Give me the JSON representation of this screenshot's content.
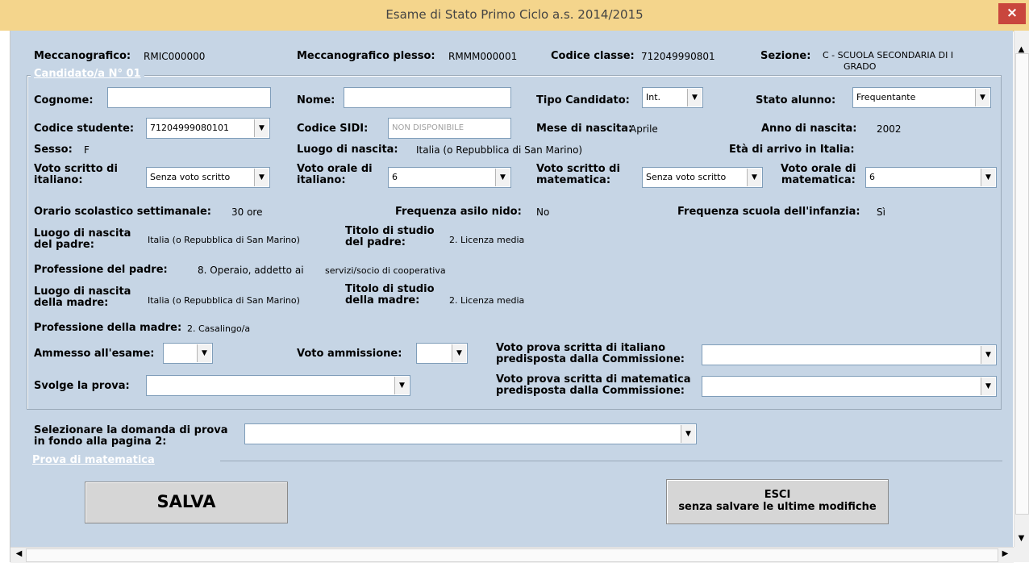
{
  "window": {
    "title": "Esame di Stato Primo Ciclo a.s. 2014/2015",
    "close_glyph": "×"
  },
  "header": {
    "meccanografico_label": "Meccanografico:",
    "meccanografico_value": "RMIC000000",
    "plesso_label": "Meccanografico plesso:",
    "plesso_value": "RMMM000001",
    "classe_label": "Codice classe:",
    "classe_value": "712049990801",
    "sezione_label": "Sezione:",
    "sezione_value_1": "C - SCUOLA SECONDARIA DI I",
    "sezione_value_2": "GRADO"
  },
  "candidate_frame": {
    "title": "Candidato/a N° 01",
    "cognome_label": "Cognome:",
    "cognome_value": "",
    "nome_label": "Nome:",
    "nome_value": "",
    "tipo_label": "Tipo Candidato:",
    "tipo_value": "Int.",
    "stato_label": "Stato alunno:",
    "stato_value": "Frequentante",
    "codice_studente_label": "Codice studente:",
    "codice_studente_value": "71204999080101",
    "codice_sidi_label": "Codice SIDI:",
    "codice_sidi_value": "NON DISPONIBILE",
    "mese_label": "Mese di nascita:",
    "mese_value": "Aprile",
    "anno_label": "Anno di nascita:",
    "anno_value": "2002",
    "sesso_label": "Sesso:",
    "sesso_value": "F",
    "luogo_label": "Luogo di nascita:",
    "luogo_value": "Italia (o Repubblica di San Marino)",
    "eta_label": "Età di arrivo in Italia:",
    "vsi_label_1": "Voto scritto di",
    "vsi_label_2": "italiano:",
    "vsi_value": "Senza voto scritto",
    "voi_label_1": "Voto orale di",
    "voi_label_2": "italiano:",
    "voi_value": "6",
    "vsm_label_1": "Voto scritto di",
    "vsm_label_2": "matematica:",
    "vsm_value": "Senza voto scritto",
    "vom_label_1": "Voto orale di",
    "vom_label_2": "matematica:",
    "vom_value": "6",
    "orario_label": "Orario scolastico settimanale:",
    "orario_value": "30 ore",
    "asilo_label": "Frequenza asilo nido:",
    "asilo_value": "No",
    "infanzia_label": "Frequenza scuola dell'infanzia:",
    "infanzia_value": "Sì",
    "lnp_label_1": "Luogo di nascita",
    "lnp_label_2": "del padre:",
    "lnp_value": "Italia (o Repubblica di San Marino)",
    "tsp_label_1": "Titolo di studio",
    "tsp_label_2": "del padre:",
    "tsp_value": "2. Licenza media",
    "prof_padre_label": "Professione del padre:",
    "prof_padre_value_a": "8. Operaio, addetto ai",
    "prof_padre_value_b": "servizi/socio di cooperativa",
    "lnm_label_1": "Luogo di nascita",
    "lnm_label_2": "della madre:",
    "lnm_value": "Italia (o Repubblica di San Marino)",
    "tsm_label_1": "Titolo di studio",
    "tsm_label_2": "della madre:",
    "tsm_value": "2. Licenza media",
    "prof_madre_label": "Professione della madre:",
    "prof_madre_value": "2. Casalingo/a",
    "ammesso_label": "Ammesso all'esame:",
    "ammesso_value": "",
    "voto_amm_label": "Voto ammissione:",
    "voto_amm_value": "",
    "vpi_label_1": "Voto prova scritta di italiano",
    "vpi_label_2": "predisposta dalla Commissione:",
    "vpi_value": "",
    "svolge_label": "Svolge la prova:",
    "svolge_value": "",
    "vpm_label_1": "Voto prova scritta di matematica",
    "vpm_label_2": "predisposta dalla Commissione:",
    "vpm_value": ""
  },
  "domanda": {
    "label_1": "Selezionare la domanda di prova",
    "label_2": "in fondo alla pagina 2:",
    "value": ""
  },
  "math_frame": {
    "title": "Prova di matematica"
  },
  "buttons": {
    "salva": "SALVA",
    "esci_1": "ESCI",
    "esci_2": "senza salvare le ultime modifiche"
  },
  "scrollbars": {
    "up_glyph": "▲",
    "down_glyph": "▼",
    "left_glyph": "◀",
    "right_glyph": "▶"
  },
  "dropdown_glyph": "▼",
  "colors": {
    "titlebar": "#f4d58c",
    "client_bg": "#c6d5e5",
    "close_button": "#c9463d"
  }
}
